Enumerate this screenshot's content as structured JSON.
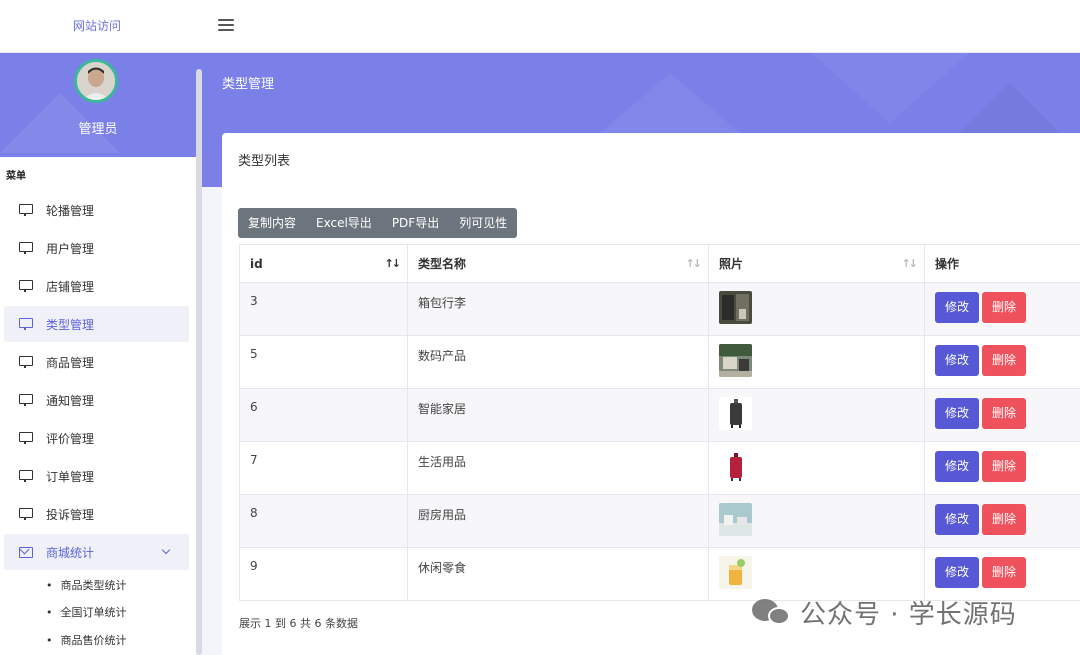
{
  "header": {
    "site_link": "网站访问"
  },
  "banner": {
    "page_title": "类型管理"
  },
  "profile": {
    "name": "管理员"
  },
  "menu": {
    "heading": "菜单",
    "items": [
      {
        "label": "轮播管理",
        "icon": "monitor-icon"
      },
      {
        "label": "用户管理",
        "icon": "monitor-icon"
      },
      {
        "label": "店铺管理",
        "icon": "monitor-icon"
      },
      {
        "label": "类型管理",
        "icon": "monitor-icon",
        "active": true
      },
      {
        "label": "商品管理",
        "icon": "monitor-icon"
      },
      {
        "label": "通知管理",
        "icon": "monitor-icon"
      },
      {
        "label": "评价管理",
        "icon": "monitor-icon"
      },
      {
        "label": "订单管理",
        "icon": "monitor-icon"
      },
      {
        "label": "投诉管理",
        "icon": "monitor-icon"
      },
      {
        "label": "商城统计",
        "icon": "mail-icon",
        "expanded": true
      }
    ],
    "sub_items": [
      "商品类型统计",
      "全国订单统计",
      "商品售价统计"
    ]
  },
  "card": {
    "title": "类型列表",
    "toolbar": [
      "复制内容",
      "Excel导出",
      "PDF导出",
      "列可见性"
    ],
    "columns": [
      "id",
      "类型名称",
      "照片",
      "操作"
    ],
    "rows": [
      {
        "id": "3",
        "name": "箱包行李"
      },
      {
        "id": "5",
        "name": "数码产品"
      },
      {
        "id": "6",
        "name": "智能家居"
      },
      {
        "id": "7",
        "name": "生活用品"
      },
      {
        "id": "8",
        "name": "厨房用品"
      },
      {
        "id": "9",
        "name": "休闲零食"
      }
    ],
    "edit_label": "修改",
    "delete_label": "删除",
    "summary": "展示 1 到 6 共 6 条数据"
  },
  "watermark": {
    "text": "公众号 · 学长源码"
  },
  "colors": {
    "accent": "#7a80e8",
    "edit": "#5658d6",
    "delete": "#f0525d",
    "toolbar": "#6c757d"
  }
}
